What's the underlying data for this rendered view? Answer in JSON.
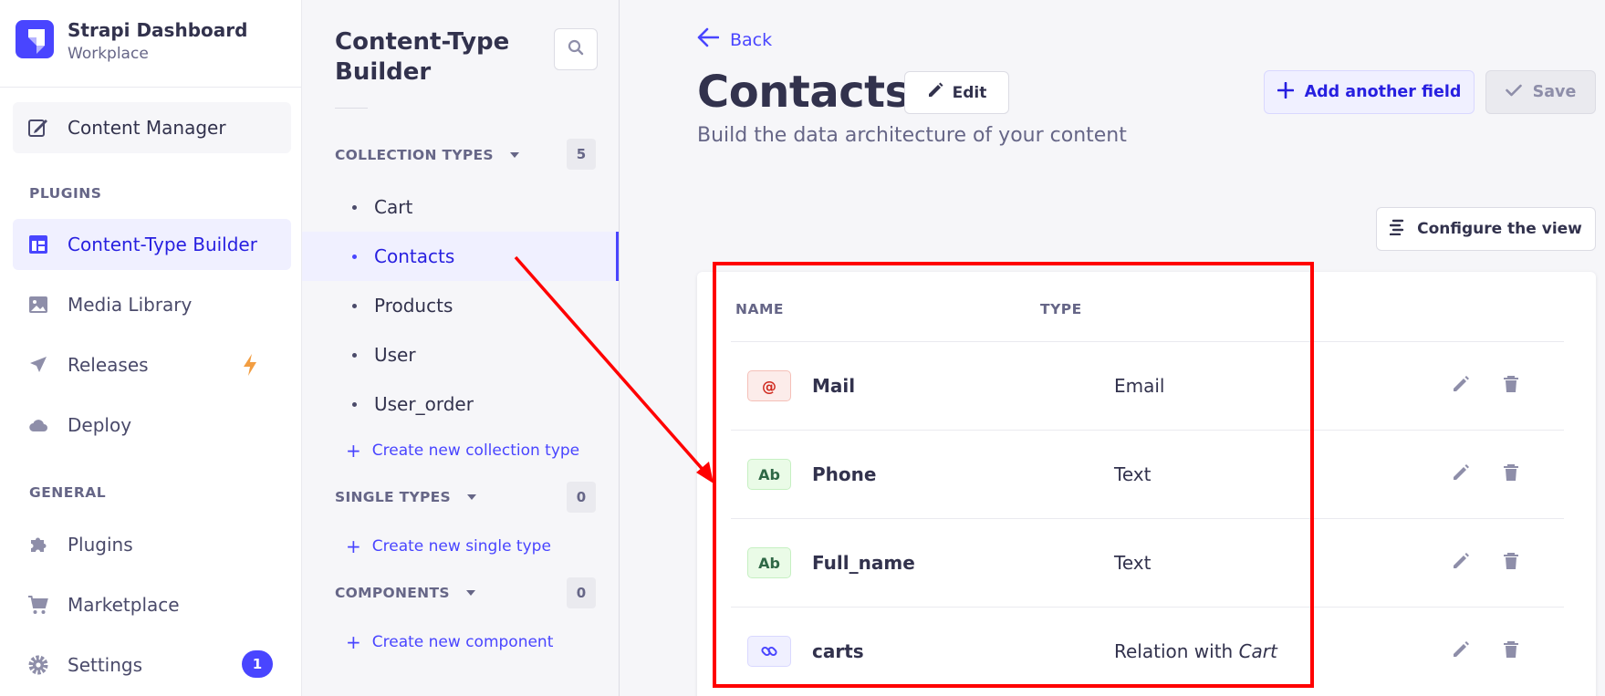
{
  "brand": {
    "title": "Strapi Dashboard",
    "subtitle": "Workplace"
  },
  "mainnav": {
    "content_manager": "Content Manager",
    "plugins_heading": "PLUGINS",
    "plugins_items": [
      {
        "label": "Content-Type Builder",
        "icon": "layout-icon"
      },
      {
        "label": "Media Library",
        "icon": "image-icon"
      },
      {
        "label": "Releases",
        "icon": "paper-plane-icon"
      },
      {
        "label": "Deploy",
        "icon": "cloud-icon"
      }
    ],
    "general_heading": "GENERAL",
    "general_items": [
      {
        "label": "Plugins",
        "icon": "puzzle-icon"
      },
      {
        "label": "Marketplace",
        "icon": "cart-icon"
      },
      {
        "label": "Settings",
        "icon": "gear-icon",
        "badge": "1"
      }
    ]
  },
  "subnav": {
    "title": "Content-Type Builder",
    "collection_types": {
      "heading": "COLLECTION TYPES",
      "count": "5",
      "items": [
        "Cart",
        "Contacts",
        "Products",
        "User",
        "User_order"
      ],
      "active": "Contacts",
      "create_label": "Create new collection type"
    },
    "single_types": {
      "heading": "SINGLE TYPES",
      "count": "0",
      "create_label": "Create new single type"
    },
    "components": {
      "heading": "COMPONENTS",
      "count": "0",
      "create_label": "Create new component"
    }
  },
  "main": {
    "back_label": "Back",
    "title": "Contacts",
    "edit_label": "Edit",
    "subtitle": "Build the data architecture of your content",
    "add_field_label": "Add another field",
    "save_label": "Save",
    "configure_label": "Configure the view",
    "table": {
      "headers": {
        "name": "NAME",
        "type": "TYPE"
      },
      "rows": [
        {
          "badge": "@",
          "badge_kind": "email",
          "name": "Mail",
          "type": "Email"
        },
        {
          "badge": "Ab",
          "badge_kind": "text",
          "name": "Phone",
          "type": "Text"
        },
        {
          "badge": "Ab",
          "badge_kind": "text",
          "name": "Full_name",
          "type": "Text"
        },
        {
          "badge": "link-icon",
          "badge_kind": "relation",
          "name": "carts",
          "type_prefix": "Relation with",
          "type_target": "Cart"
        }
      ]
    }
  },
  "colors": {
    "accent": "#4945ff",
    "annotation": "#ff0000"
  }
}
